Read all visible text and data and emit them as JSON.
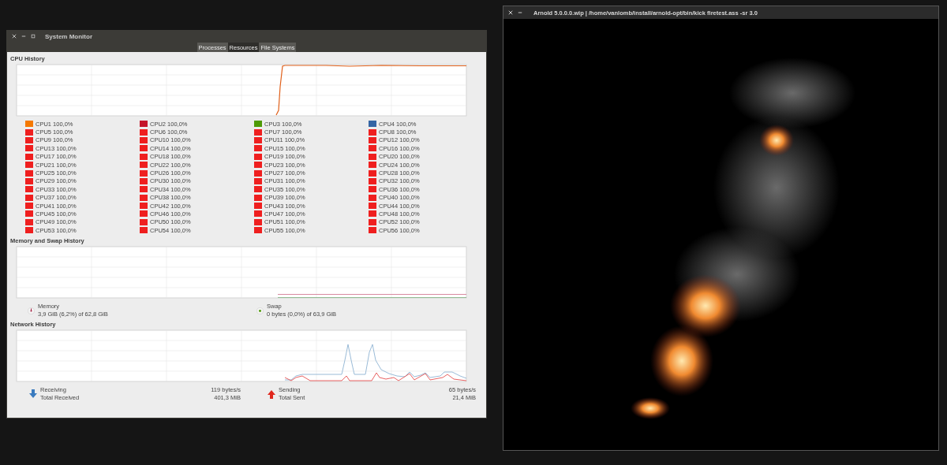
{
  "system_monitor": {
    "title": "System Monitor",
    "tabs": [
      {
        "label": "Processes",
        "selected": false
      },
      {
        "label": "Resources",
        "selected": true
      },
      {
        "label": "File Systems",
        "selected": false
      }
    ],
    "cpu_history": {
      "title": "CPU History",
      "cpus": [
        {
          "label": "CPU1 100,0%",
          "color": "#f57900"
        },
        {
          "label": "CPU2 100,0%",
          "color": "#c4152a"
        },
        {
          "label": "CPU3 100,0%",
          "color": "#4e9a06"
        },
        {
          "label": "CPU4 100,0%",
          "color": "#3465a4"
        },
        {
          "label": "CPU5 100,0%",
          "color": "#ef1f1f"
        },
        {
          "label": "CPU6 100,0%",
          "color": "#ef1f1f"
        },
        {
          "label": "CPU7 100,0%",
          "color": "#ef1f1f"
        },
        {
          "label": "CPU8 100,0%",
          "color": "#ef1f1f"
        },
        {
          "label": "CPU9 100,0%",
          "color": "#ef1f1f"
        },
        {
          "label": "CPU10 100,0%",
          "color": "#ef1f1f"
        },
        {
          "label": "CPU11 100,0%",
          "color": "#ef1f1f"
        },
        {
          "label": "CPU12 100,0%",
          "color": "#ef1f1f"
        },
        {
          "label": "CPU13 100,0%",
          "color": "#ef1f1f"
        },
        {
          "label": "CPU14 100,0%",
          "color": "#ef1f1f"
        },
        {
          "label": "CPU15 100,0%",
          "color": "#ef1f1f"
        },
        {
          "label": "CPU16 100,0%",
          "color": "#ef1f1f"
        },
        {
          "label": "CPU17 100,0%",
          "color": "#ef1f1f"
        },
        {
          "label": "CPU18 100,0%",
          "color": "#ef1f1f"
        },
        {
          "label": "CPU19 100,0%",
          "color": "#ef1f1f"
        },
        {
          "label": "CPU20 100,0%",
          "color": "#ef1f1f"
        },
        {
          "label": "CPU21 100,0%",
          "color": "#ef1f1f"
        },
        {
          "label": "CPU22 100,0%",
          "color": "#ef1f1f"
        },
        {
          "label": "CPU23 100,0%",
          "color": "#ef1f1f"
        },
        {
          "label": "CPU24 100,0%",
          "color": "#ef1f1f"
        },
        {
          "label": "CPU25 100,0%",
          "color": "#ef1f1f"
        },
        {
          "label": "CPU26 100,0%",
          "color": "#ef1f1f"
        },
        {
          "label": "CPU27 100,0%",
          "color": "#ef1f1f"
        },
        {
          "label": "CPU28 100,0%",
          "color": "#ef1f1f"
        },
        {
          "label": "CPU29 100,0%",
          "color": "#ef1f1f"
        },
        {
          "label": "CPU30 100,0%",
          "color": "#ef1f1f"
        },
        {
          "label": "CPU31 100,0%",
          "color": "#ef1f1f"
        },
        {
          "label": "CPU32 100,0%",
          "color": "#ef1f1f"
        },
        {
          "label": "CPU33 100,0%",
          "color": "#ef1f1f"
        },
        {
          "label": "CPU34 100,0%",
          "color": "#ef1f1f"
        },
        {
          "label": "CPU35 100,0%",
          "color": "#ef1f1f"
        },
        {
          "label": "CPU36 100,0%",
          "color": "#ef1f1f"
        },
        {
          "label": "CPU37 100,0%",
          "color": "#ef1f1f"
        },
        {
          "label": "CPU38 100,0%",
          "color": "#ef1f1f"
        },
        {
          "label": "CPU39 100,0%",
          "color": "#ef1f1f"
        },
        {
          "label": "CPU40 100,0%",
          "color": "#ef1f1f"
        },
        {
          "label": "CPU41 100,0%",
          "color": "#ef1f1f"
        },
        {
          "label": "CPU42 100,0%",
          "color": "#ef1f1f"
        },
        {
          "label": "CPU43 100,0%",
          "color": "#ef1f1f"
        },
        {
          "label": "CPU44 100,0%",
          "color": "#ef1f1f"
        },
        {
          "label": "CPU45 100,0%",
          "color": "#ef1f1f"
        },
        {
          "label": "CPU46 100,0%",
          "color": "#ef1f1f"
        },
        {
          "label": "CPU47 100,0%",
          "color": "#ef1f1f"
        },
        {
          "label": "CPU48 100,0%",
          "color": "#ef1f1f"
        },
        {
          "label": "CPU49 100,0%",
          "color": "#ef1f1f"
        },
        {
          "label": "CPU50 100,0%",
          "color": "#ef1f1f"
        },
        {
          "label": "CPU51 100,0%",
          "color": "#ef1f1f"
        },
        {
          "label": "CPU52 100,0%",
          "color": "#ef1f1f"
        },
        {
          "label": "CPU53 100,0%",
          "color": "#ef1f1f"
        },
        {
          "label": "CPU54 100,0%",
          "color": "#ef1f1f"
        },
        {
          "label": "CPU55 100,0%",
          "color": "#ef1f1f"
        },
        {
          "label": "CPU56 100,0%",
          "color": "#ef1f1f"
        }
      ]
    },
    "memory_swap": {
      "title": "Memory and Swap History",
      "memory": {
        "label": "Memory",
        "value": "3,9 GiB (6,2%) of 62,8 GiB"
      },
      "swap": {
        "label": "Swap",
        "value": "0 bytes (0,0%) of 63,9 GiB"
      }
    },
    "network": {
      "title": "Network History",
      "receiving": {
        "label": "Receiving",
        "rate": "119 bytes/s",
        "total_label": "Total Received",
        "total": "401,3 MiB"
      },
      "sending": {
        "label": "Sending",
        "rate": "65 bytes/s",
        "total_label": "Total Sent",
        "total": "21,4 MiB"
      }
    }
  },
  "render_window": {
    "title": "Arnold 5.0.0.0.wip | /home/vanlomb/install/arnold-opt/bin/kick firetest.ass -sr 3.0"
  }
}
